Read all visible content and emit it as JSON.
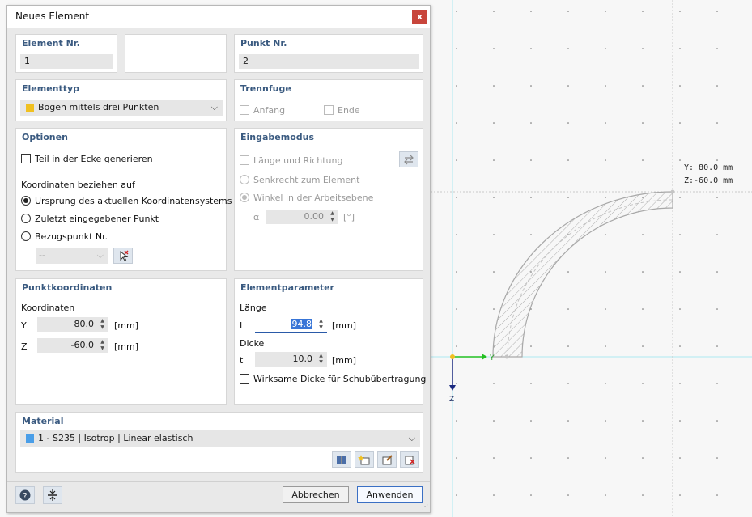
{
  "dialog": {
    "title": "Neues Element",
    "close_label": "x"
  },
  "element_nr": {
    "label": "Element Nr.",
    "value": "1"
  },
  "punkt_nr": {
    "label": "Punkt Nr.",
    "value": "2"
  },
  "elementtyp": {
    "label": "Elementtyp",
    "selected": "Bogen mittels drei Punkten",
    "swatch_color": "#f0c020"
  },
  "trennfuge": {
    "label": "Trennfuge",
    "anfang": "Anfang",
    "ende": "Ende"
  },
  "optionen": {
    "label": "Optionen",
    "teil_ecke": "Teil in der Ecke generieren",
    "koord_label": "Koordinaten beziehen auf",
    "radio_ursprung": "Ursprung des aktuellen Koordinatensystems",
    "radio_zuletzt": "Zuletzt eingegebener Punkt",
    "radio_bezug": "Bezugspunkt Nr.",
    "bezug_value": "--"
  },
  "eingabemodus": {
    "label": "Eingabemodus",
    "laenge_richtung": "Länge und Richtung",
    "senkrecht": "Senkrecht zum Element",
    "winkel": "Winkel in der Arbeitsebene",
    "alpha_symbol": "α",
    "alpha_value": "0.00",
    "alpha_unit": "[°]"
  },
  "punktkoordinaten": {
    "label": "Punktkoordinaten",
    "koordinaten": "Koordinaten",
    "y_label": "Y",
    "y_value": "80.0",
    "z_label": "Z",
    "z_value": "-60.0",
    "unit": "[mm]"
  },
  "elementparameter": {
    "label": "Elementparameter",
    "laenge": "Länge",
    "l_label": "L",
    "l_value": "94.8",
    "dicke": "Dicke",
    "t_label": "t",
    "t_value": "10.0",
    "unit": "[mm]",
    "wirksame": "Wirksame Dicke für Schubübertragung"
  },
  "material": {
    "label": "Material",
    "selected": "1 - S235 | Isotrop | Linear elastisch",
    "swatch_color": "#4a9ee8"
  },
  "buttons": {
    "abbrechen": "Abbrechen",
    "anwenden": "Anwenden"
  },
  "canvas": {
    "coord_y": "Y:  80.0  mm",
    "coord_z": "Z:-60.0  mm",
    "axis_y": "Y",
    "axis_z": "Z"
  }
}
